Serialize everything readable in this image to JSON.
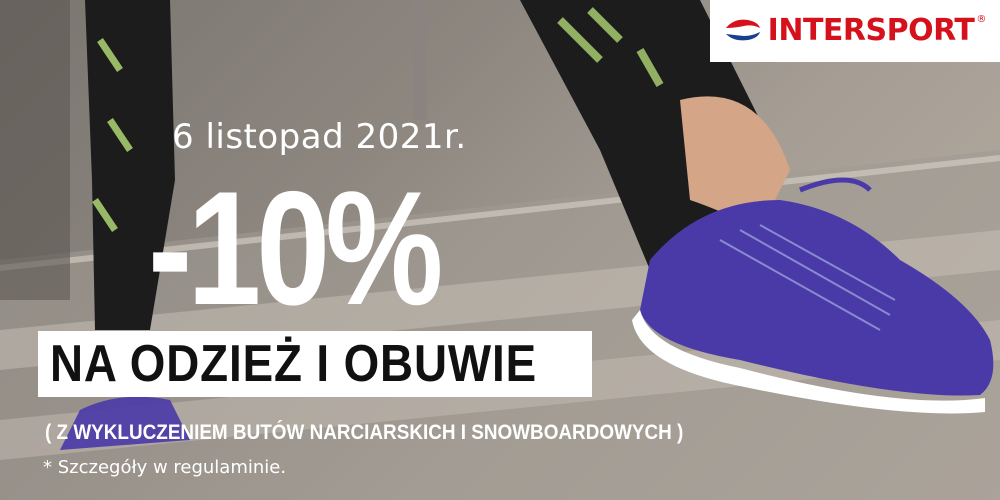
{
  "brand": {
    "name": "INTERSPORT",
    "registered": "®",
    "brand_color": "#d5121b"
  },
  "promo": {
    "date": "6 listopad 2021r.",
    "discount": "-10%",
    "headline": "NA ODZIEŻ I OBUWIE",
    "exclusion": "( Z WYKLUCZENIEM BUTÓW NARCIARSKICH I SNOWBOARDOWYCH )",
    "note": "* Szczegóły w regulaminie."
  },
  "colors": {
    "shoe": "#4a3aa8",
    "legging": "#1c1c1c",
    "accent_lime": "#b8e27a"
  }
}
